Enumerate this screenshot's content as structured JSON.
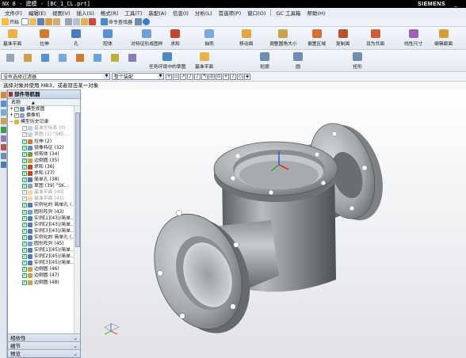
{
  "window": {
    "title": "NX 8 - 建模 - [BC_1_CL.prt]",
    "brand": "SIEMENS",
    "minimize": "_"
  },
  "menu": [
    "文件(F)",
    "编辑(E)",
    "视图(V)",
    "插入(S)",
    "格式(R)",
    "工具(T)",
    "装配(A)",
    "信息(I)",
    "分析(L)",
    "首选项(P)",
    "窗口(O)",
    "GC 工具箱",
    "帮助(H)"
  ],
  "toolbar1": {
    "start": "开始",
    "assembly_nav": "命令查找器"
  },
  "feature_commands": [
    {
      "label": "基准平面",
      "color": "#e9b24a"
    },
    {
      "label": "拉伸",
      "color": "#d07a2c"
    },
    {
      "label": "孔",
      "color": "#4c7bc0"
    },
    {
      "label": "腔体",
      "color": "#5a8fd0"
    },
    {
      "label": "对特征形成图样",
      "color": "#6aa1d8"
    },
    {
      "label": "求和",
      "color": "#c2462f"
    },
    {
      "label": "抽壳",
      "color": "#7aa9d9"
    },
    {
      "label": "移动面",
      "color": "#e2a63c"
    },
    {
      "label": "调整圆角大小",
      "color": "#c9a24a"
    },
    {
      "label": "偏置区域",
      "color": "#d26f3a"
    },
    {
      "label": "复制面",
      "color": "#b8532d"
    },
    {
      "label": "设为共面",
      "color": "#cc5e35"
    },
    {
      "label": "线性尺寸",
      "color": "#a05fb6"
    },
    {
      "label": "编辑截面",
      "color": "#d49f3a"
    }
  ],
  "sketch_commands": [
    {
      "label": "任务环境中的草图",
      "color": "#4d89c9"
    },
    {
      "label": "基准平面",
      "color": "#e9b24a"
    },
    {
      "label": "轮廓",
      "color": "#6f8db0"
    },
    {
      "label": "圆",
      "color": "#6f8db0"
    },
    {
      "label": "矩形",
      "color": "#6f8db0"
    }
  ],
  "selection": {
    "filter": "没有选择过滤器",
    "scope": "整个装配"
  },
  "cue": "选择对象并使用 MB3，或者双击某一对象",
  "navigator": {
    "title": "部件导航器",
    "column": "名称",
    "root": "模型视图",
    "camera": "摄像机",
    "history": "模型历史记录",
    "features": [
      {
        "name": "基准坐标系 (0)",
        "state": "grey",
        "icon": "#7a9cc8"
      },
      {
        "name": "草图 (1) \"SKE...",
        "state": "grey",
        "icon": "#8fa4c2"
      },
      {
        "name": "拉伸 (2)",
        "state": "on",
        "icon": "#d07a2c"
      },
      {
        "name": "镜像特征 (32)",
        "state": "on",
        "icon": "#5a8fd0"
      },
      {
        "name": "修剪体 (34)",
        "state": "on",
        "icon": "#6f9e4a"
      },
      {
        "name": "边倒圆 (35)",
        "state": "on",
        "icon": "#c9a24a"
      },
      {
        "name": "求和 (36)",
        "state": "on",
        "icon": "#c2462f"
      },
      {
        "name": "求和 (37)",
        "state": "on",
        "icon": "#c2462f"
      },
      {
        "name": "简单孔 (38)",
        "state": "on",
        "icon": "#4c7bc0"
      },
      {
        "name": "草图 (39) \"SK...",
        "state": "on",
        "icon": "#8fa4c2"
      },
      {
        "name": "基准平面 (40)",
        "state": "grey",
        "icon": "#e9b24a"
      },
      {
        "name": "基准平面 (41)",
        "state": "grey",
        "icon": "#e9b24a"
      },
      {
        "name": "实例化的 简单孔 (...",
        "state": "on",
        "icon": "#4c7bc0"
      },
      {
        "name": "圆形阵列 (43)",
        "state": "on",
        "icon": "#6aa1d8"
      },
      {
        "name": "实例[1](43)/简单...",
        "state": "on",
        "icon": "#4c7bc0"
      },
      {
        "name": "实例[2](43)/简单...",
        "state": "on",
        "icon": "#4c7bc0"
      },
      {
        "name": "实例[3](43)/简单...",
        "state": "on",
        "icon": "#4c7bc0"
      },
      {
        "name": "实例化的 简单孔 (...",
        "state": "on",
        "icon": "#4c7bc0"
      },
      {
        "name": "圆形阵列 (45)",
        "state": "on",
        "icon": "#6aa1d8"
      },
      {
        "name": "实例[1](45)/简单...",
        "state": "on",
        "icon": "#4c7bc0"
      },
      {
        "name": "实例[2](45)/简单...",
        "state": "on",
        "icon": "#4c7bc0"
      },
      {
        "name": "实例[3](45)/简单...",
        "state": "on",
        "icon": "#4c7bc0"
      },
      {
        "name": "边倒圆 (46)",
        "state": "on",
        "icon": "#c9a24a"
      },
      {
        "name": "边倒圆 (47)",
        "state": "on",
        "icon": "#c9a24a"
      },
      {
        "name": "边倒圆 (48)",
        "state": "on",
        "icon": "#c9a24a"
      }
    ],
    "panels": [
      "相依性",
      "细节",
      "预览"
    ]
  }
}
